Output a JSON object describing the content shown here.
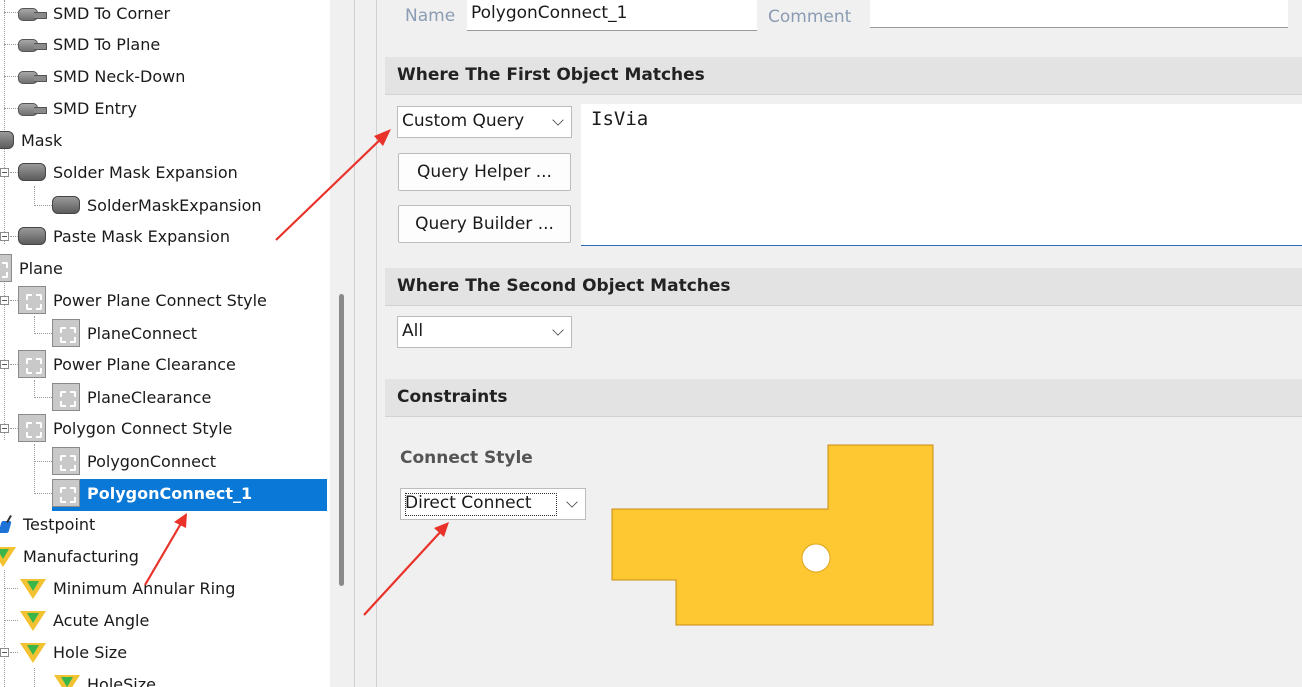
{
  "tree": {
    "items": [
      {
        "label": "SMD To Corner"
      },
      {
        "label": "SMD To Plane"
      },
      {
        "label": "SMD Neck-Down"
      },
      {
        "label": "SMD Entry"
      },
      {
        "label": "Mask"
      },
      {
        "label": "Solder Mask Expansion"
      },
      {
        "label": "SolderMaskExpansion"
      },
      {
        "label": "Paste Mask Expansion"
      },
      {
        "label": "Plane"
      },
      {
        "label": "Power Plane Connect Style"
      },
      {
        "label": "PlaneConnect"
      },
      {
        "label": "Power Plane Clearance"
      },
      {
        "label": "PlaneClearance"
      },
      {
        "label": "Polygon Connect Style"
      },
      {
        "label": "PolygonConnect"
      },
      {
        "label": "PolygonConnect_1"
      },
      {
        "label": "Testpoint"
      },
      {
        "label": "Manufacturing"
      },
      {
        "label": "Minimum Annular Ring"
      },
      {
        "label": "Acute Angle"
      },
      {
        "label": "Hole Size"
      },
      {
        "label": "HoleSize"
      }
    ],
    "selected": "PolygonConnect_1"
  },
  "rule": {
    "name_label": "Name",
    "name_value": "PolygonConnect_1",
    "comment_label": "Comment",
    "comment_value": ""
  },
  "first_match": {
    "header": "Where The First Object Matches",
    "scope": "Custom Query",
    "query_helper": "Query Helper ...",
    "query_builder": "Query Builder ...",
    "query": "IsVia"
  },
  "second_match": {
    "header": "Where The Second Object Matches",
    "scope": "All"
  },
  "constraints": {
    "header": "Constraints",
    "connect_style_label": "Connect Style",
    "connect_style": "Direct Connect",
    "preview_color": "#fec832"
  },
  "annotation_color": "#e8322a"
}
